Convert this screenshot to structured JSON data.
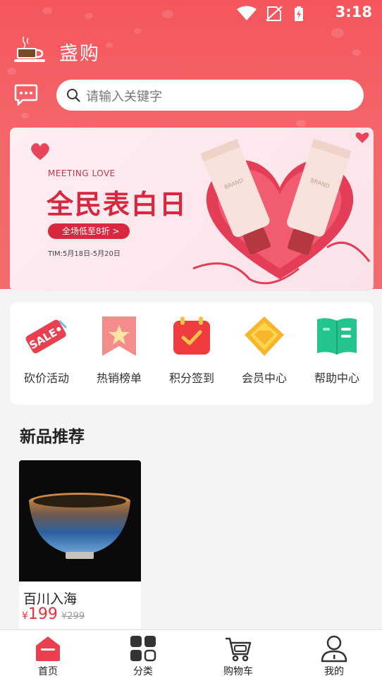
{
  "status_bar": {
    "time": "3:18"
  },
  "header": {
    "brand_name": "盏购",
    "search_placeholder": "请输入关键字"
  },
  "banner": {
    "subtitle": "MEETING LOVE",
    "title": "全民表白日",
    "pill": "全场低至8折 >",
    "date": "TIM:5月18日-5月20日"
  },
  "shortcuts": [
    {
      "label": "砍价活动",
      "icon": "sale-tag-icon"
    },
    {
      "label": "热销榜单",
      "icon": "star-ribbon-icon"
    },
    {
      "label": "积分签到",
      "icon": "calendar-check-icon"
    },
    {
      "label": "会员中心",
      "icon": "diamond-icon"
    },
    {
      "label": "帮助中心",
      "icon": "book-icon"
    }
  ],
  "section": {
    "title": "新品推荐"
  },
  "products": [
    {
      "name": "百川入海",
      "currency": "¥",
      "price": "199",
      "old_price": "¥299"
    }
  ],
  "bottom_nav": [
    {
      "label": "首页",
      "icon": "home-icon",
      "active": true
    },
    {
      "label": "分类",
      "icon": "grid-icon",
      "active": false
    },
    {
      "label": "购物车",
      "icon": "cart-icon",
      "active": false
    },
    {
      "label": "我的",
      "icon": "user-icon",
      "active": false
    }
  ],
  "colors": {
    "brand": "#f4565d",
    "price": "#e8303c",
    "banner_accent": "#d7283f"
  }
}
